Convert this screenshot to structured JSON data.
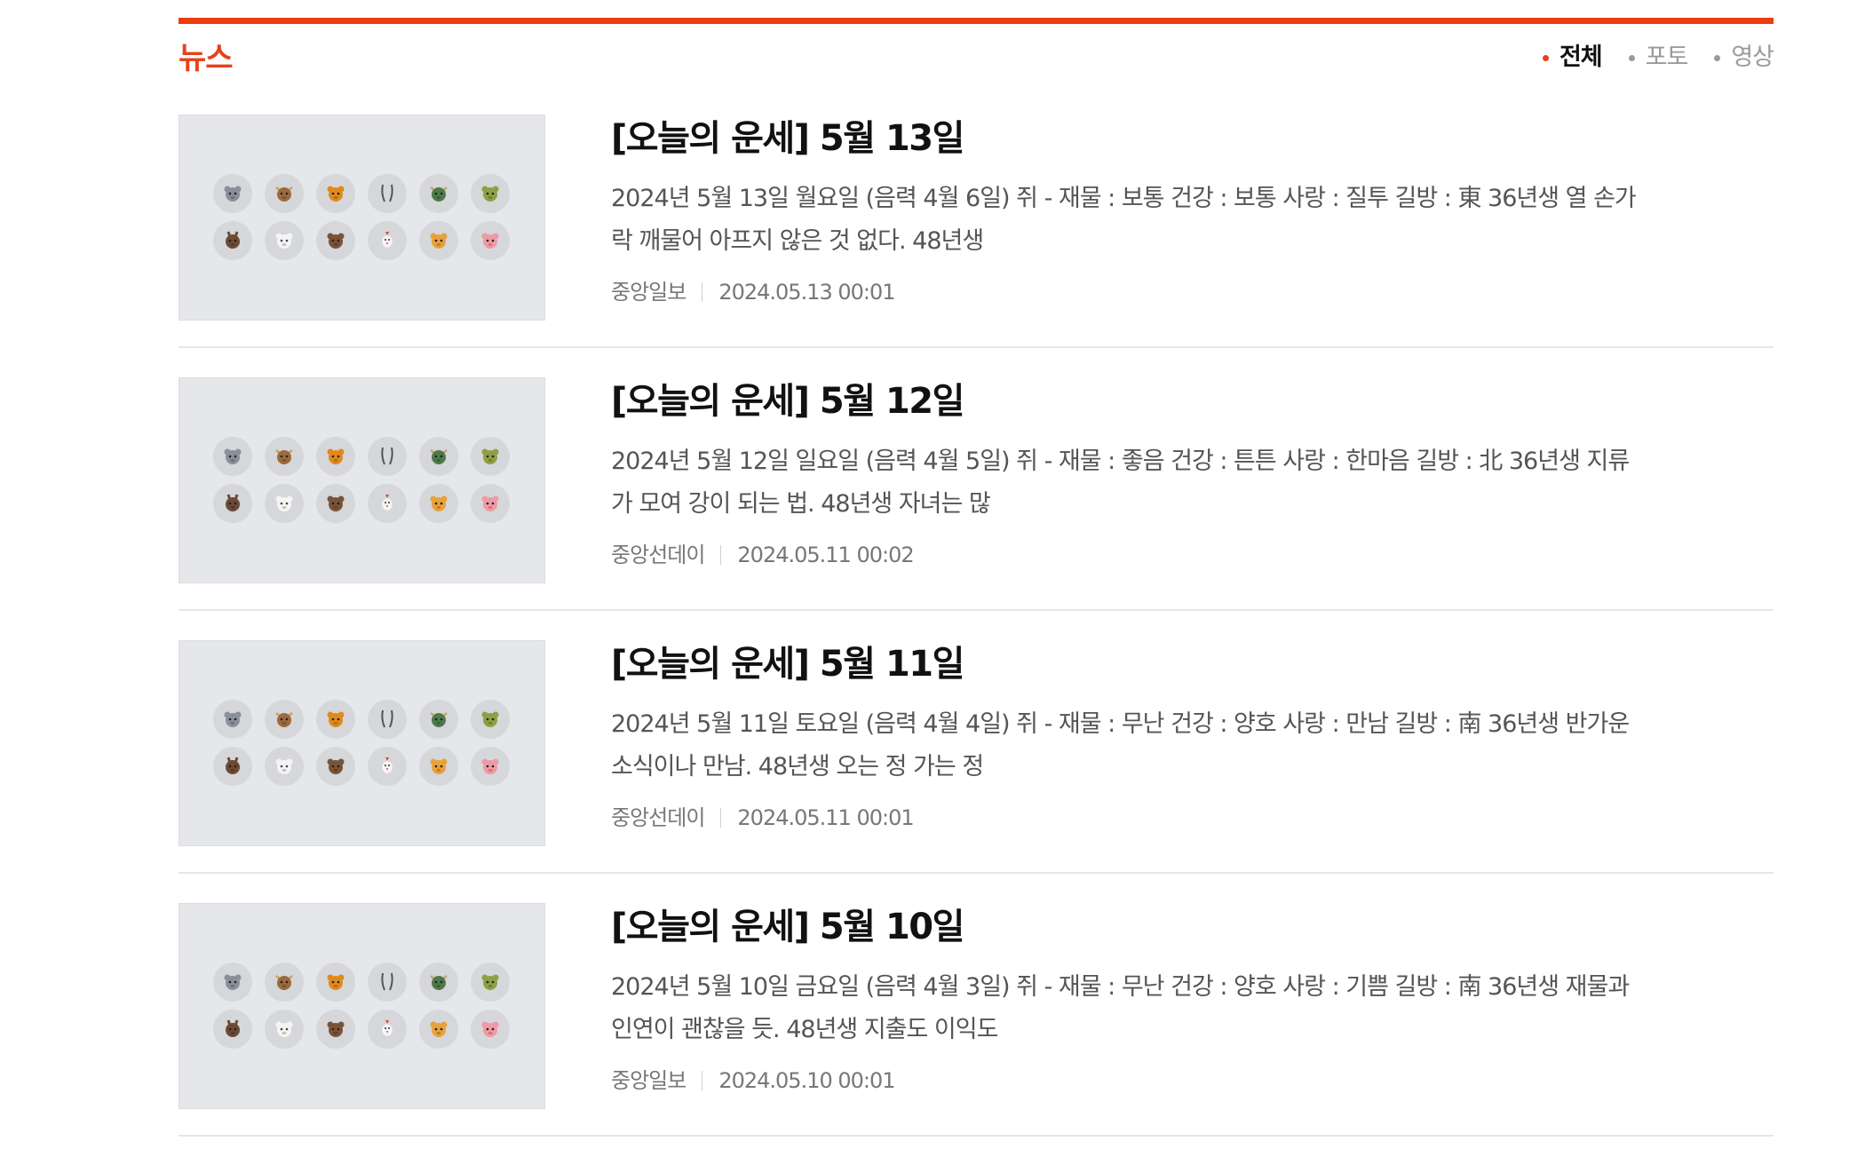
{
  "section": {
    "title": "뉴스",
    "accent_color": "#ec3c10"
  },
  "filters": [
    {
      "label": "전체",
      "active": true
    },
    {
      "label": "포토",
      "active": false
    },
    {
      "label": "영상",
      "active": false
    }
  ],
  "articles": [
    {
      "title": "[오늘의 운세] 5월 13일",
      "summary": "2024년 5월 13일 월요일 (음력 4월 6일)    쥐 - 재물 : 보통 건강 : 보통 사랑 : 질투 길방 : 東 36년생 열 손가락 깨물어 아프지 않은 것 없다. 48년생",
      "source": "중앙일보",
      "datetime": "2024.05.13 00:01"
    },
    {
      "title": "[오늘의 운세] 5월 12일",
      "summary": "2024년 5월 12일 일요일 (음력 4월 5일)    쥐 - 재물 : 좋음 건강 : 튼튼 사랑 : 한마음 길방 : 北 36년생 지류가 모여 강이 되는 법. 48년생 자녀는 많",
      "source": "중앙선데이",
      "datetime": "2024.05.11 00:02"
    },
    {
      "title": "[오늘의 운세] 5월 11일",
      "summary": "2024년 5월 11일 토요일 (음력 4월 4일)    쥐 - 재물 : 무난 건강 : 양호 사랑 : 만남 길방 : 南 36년생 반가운 소식이나 만남. 48년생 오는 정 가는 정",
      "source": "중앙선데이",
      "datetime": "2024.05.11 00:01"
    },
    {
      "title": "[오늘의 운세] 5월 10일",
      "summary": "2024년 5월 10일 금요일 (음력 4월 3일)    쥐 - 재물 : 무난 건강 : 양호 사랑 : 기쁨 길방 : 南 36년생 재물과 인연이 괜찮을 듯. 48년생 지출도 이익도",
      "source": "중앙일보",
      "datetime": "2024.05.10 00:01"
    }
  ],
  "zodiac_icons": [
    {
      "name": "rat-icon",
      "color": "#8a909a"
    },
    {
      "name": "ox-icon",
      "color": "#9b6a3e"
    },
    {
      "name": "tiger-icon",
      "color": "#e08a1e"
    },
    {
      "name": "rabbit-icon",
      "color": "#555555"
    },
    {
      "name": "dragon-icon",
      "color": "#4e7a4a"
    },
    {
      "name": "snake-icon",
      "color": "#8fa044"
    },
    {
      "name": "horse-icon",
      "color": "#6b4a36"
    },
    {
      "name": "sheep-icon",
      "color": "#f4f4f2"
    },
    {
      "name": "monkey-icon",
      "color": "#7a5238"
    },
    {
      "name": "rooster-icon",
      "color": "#f6f6f6"
    },
    {
      "name": "dog-icon",
      "color": "#e9a13a"
    },
    {
      "name": "pig-icon",
      "color": "#ef9aa4"
    }
  ]
}
